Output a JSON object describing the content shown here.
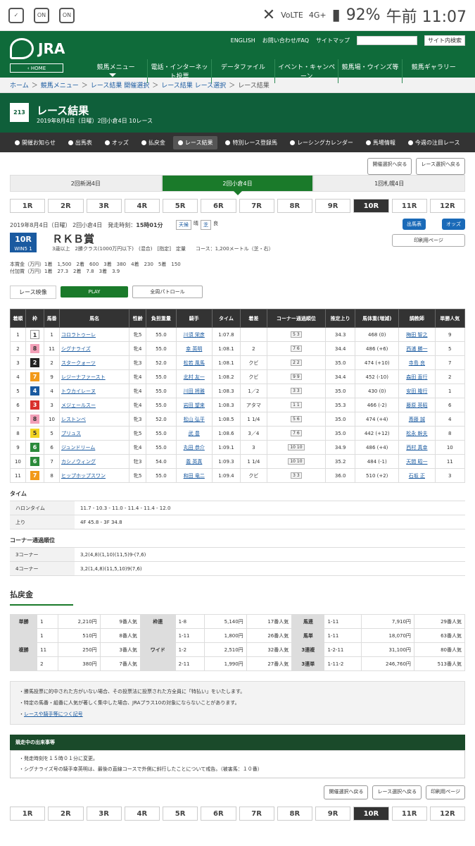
{
  "status": {
    "battery": "92%",
    "time": "午前 11:07",
    "network": "4G+",
    "volte": "VoLTE"
  },
  "header": {
    "logo": "JRA",
    "home": "‹ HOME",
    "links": [
      "ENGLISH",
      "お問い合わせ/FAQ",
      "サイトマップ"
    ],
    "search_btn": "サイト内検索",
    "nav": [
      "競馬メニュー",
      "電話・インターネット投票",
      "データファイル",
      "イベント・キャンペーン",
      "競馬場・ウインズ等",
      "競馬ギャラリー"
    ]
  },
  "breadcrumb": [
    "ホーム",
    "競馬メニュー",
    "レース結果 開催選択",
    "レース結果 レース選択",
    "レース結果"
  ],
  "title": {
    "main": "レース結果",
    "sub": "2019年8月4日（日曜）2回小倉4日 10レース"
  },
  "subnav": [
    "開催お知らせ",
    "出馬表",
    "オッズ",
    "払戻金",
    "レース結果",
    "特別レース登録馬",
    "レーシングカレンダー",
    "馬場情報",
    "今週の注目レース"
  ],
  "util": {
    "prev": "開催選択へ戻る",
    "race": "レース選択へ戻る",
    "print": "印刷用ページ"
  },
  "venues": [
    "2回新潟4日",
    "2回小倉4日",
    "1回札幌4日"
  ],
  "races": [
    "1R",
    "2R",
    "3R",
    "4R",
    "5R",
    "6R",
    "7R",
    "8R",
    "9R",
    "10R",
    "11R",
    "12R"
  ],
  "race": {
    "date": "2019年8月4日（日曜） 2回小倉4日",
    "start_label": "発走時刻：",
    "start": "15時01分",
    "weather_k": "天候",
    "weather": "晴",
    "track_k": "芝",
    "track": "良",
    "num": "10R",
    "win5": "WIN5 1",
    "name": "ＲＫＢ賞",
    "cond": "3歳以上　2勝クラス(1000万円以下)　(混合)　[指定]　定量　　コース：1,200メートル（芝・右）",
    "prize1": "本賞金（万円）1着　1,500　2着　600　3着　380　4着　230　5着　150",
    "prize2": "付加賞（万円）1着　27.3　2着　7.8　3着　3.9",
    "btn_shutuba": "出馬表",
    "btn_odds": "オッズ"
  },
  "video": {
    "label": "レース映像",
    "play": "PLAY",
    "patrol": "全周パトロール"
  },
  "table": {
    "headers": [
      "着順",
      "枠",
      "馬番",
      "馬名",
      "性齢",
      "負担重量",
      "騎手",
      "タイム",
      "着差",
      "コーナー通過順位",
      "推定上り",
      "馬体重(増減)",
      "調教師",
      "単勝人気"
    ],
    "rows": [
      [
        "1",
        "1",
        "1",
        "コロラトゥーレ",
        "牝5",
        "55.0",
        "川須 栄彦",
        "1:07.8",
        "",
        "5 3",
        "34.3",
        "468 (0)",
        "梅田 智之",
        "9"
      ],
      [
        "2",
        "8",
        "11",
        "シグナライズ",
        "牝4",
        "55.0",
        "幸 英明",
        "1:08.1",
        "2",
        "7 6",
        "34.4",
        "486 (+6)",
        "西浦 勝一",
        "5"
      ],
      [
        "3",
        "2",
        "2",
        "スタークォーツ",
        "牝3",
        "52.0",
        "松若 風馬",
        "1:08.1",
        "クビ",
        "2 2",
        "35.0",
        "474 (+10)",
        "寺島 良",
        "7"
      ],
      [
        "4",
        "7",
        "9",
        "レジーナファースト",
        "牝4",
        "55.0",
        "北村 友一",
        "1:08.2",
        "クビ",
        "9 9",
        "34.4",
        "452 (-10)",
        "森田 直行",
        "2"
      ],
      [
        "5",
        "4",
        "4",
        "トウカイレーヌ",
        "牝4",
        "55.0",
        "川田 将雅",
        "1:08.3",
        "1／2",
        "3 3",
        "35.0",
        "430 (0)",
        "安田 隆行",
        "1"
      ],
      [
        "6",
        "3",
        "3",
        "メジェールスー",
        "牝4",
        "55.0",
        "岩田 望来",
        "1:08.3",
        "アタマ",
        "1 1",
        "35.3",
        "466 (-2)",
        "藤原 英昭",
        "6"
      ],
      [
        "7",
        "8",
        "10",
        "レストンベ",
        "牝3",
        "52.0",
        "松山 弘平",
        "1:08.5",
        "1 1/4",
        "5 6",
        "35.0",
        "474 (+4)",
        "斎藤 誠",
        "4"
      ],
      [
        "8",
        "5",
        "5",
        "プリュス",
        "牝5",
        "55.0",
        "武 豊",
        "1:08.6",
        "3／4",
        "7 6",
        "35.0",
        "442 (+12)",
        "松永 幹夫",
        "8"
      ],
      [
        "9",
        "6",
        "6",
        "ジュンドリーム",
        "牝4",
        "55.0",
        "丸田 恭介",
        "1:09.1",
        "3",
        "10 10",
        "34.9",
        "486 (+4)",
        "西村 真幸",
        "10"
      ],
      [
        "10",
        "6",
        "7",
        "カシノウィング",
        "牡3",
        "54.0",
        "義 英真",
        "1:09.3",
        "1 1/4",
        "10 10",
        "35.2",
        "484 (-1)",
        "天間 昭一",
        "11"
      ],
      [
        "11",
        "7",
        "8",
        "ヒップホップスワン",
        "牝5",
        "55.0",
        "和田 竜二",
        "1:09.4",
        "クビ",
        "3 3",
        "36.0",
        "510 (+2)",
        "石坂 正",
        "3"
      ]
    ]
  },
  "time": {
    "h": "タイム",
    "halon_k": "ハロンタイム",
    "halon": "11.7 - 10.3 - 11.0 - 11.4 - 11.4 - 12.0",
    "agari_k": "上り",
    "agari": "4F 45.8 - 3F 34.8"
  },
  "corner": {
    "h": "コーナー通過順位",
    "c3_k": "3コーナー",
    "c3": "3,2(4,8)(1,10)(11,5)9-(7,6)",
    "c4_k": "4コーナー",
    "c4": "3,2(1,4,8)(11,5,10)9(7,6)"
  },
  "pay": {
    "h": "払戻金",
    "rows": [
      [
        "単勝",
        "1",
        "2,210円",
        "9番人気",
        "枠連",
        "1-8",
        "5,140円",
        "17番人気",
        "馬連",
        "1-11",
        "7,910円",
        "29番人気"
      ],
      [
        "",
        "1",
        "510円",
        "8番人気",
        "",
        "1-11",
        "1,800円",
        "26番人気",
        "馬単",
        "1-11",
        "18,070円",
        "63番人気"
      ],
      [
        "複勝",
        "11",
        "250円",
        "3番人気",
        "ワイド",
        "1-2",
        "2,510円",
        "32番人気",
        "3連複",
        "1-2-11",
        "31,100円",
        "80番人気"
      ],
      [
        "",
        "2",
        "380円",
        "7番人気",
        "",
        "2-11",
        "1,990円",
        "27番人気",
        "3連単",
        "1-11-2",
        "246,760円",
        "513番人気"
      ]
    ]
  },
  "notes": [
    "勝馬投票に的中された方がいない場合、その投票法に投票された方全員に「特払い」をいたします。",
    "特定の馬番・組番に人気が著しく集中した場合、JRAプラス10の対象にならないことがあります。",
    "レースや騎手等につく記号"
  ],
  "incident": {
    "h": "競走中の出来事等",
    "lines": [
      "発走時刻を１５時０１分に変更。",
      "シグナライズ号の騎手幸英明は、最後の直線コースで外側に斜行したことについて戒告。（被害馬：１０番）"
    ]
  },
  "colors": {
    "green": "#0f6b3a",
    "w1": "#ffffff",
    "w2": "#222222",
    "w3": "#d9302c",
    "w4": "#1a5aa0",
    "w5": "#f2d422",
    "w6": "#2a8a3a",
    "w7": "#f29a1a",
    "w8": "#f2a0b8"
  }
}
